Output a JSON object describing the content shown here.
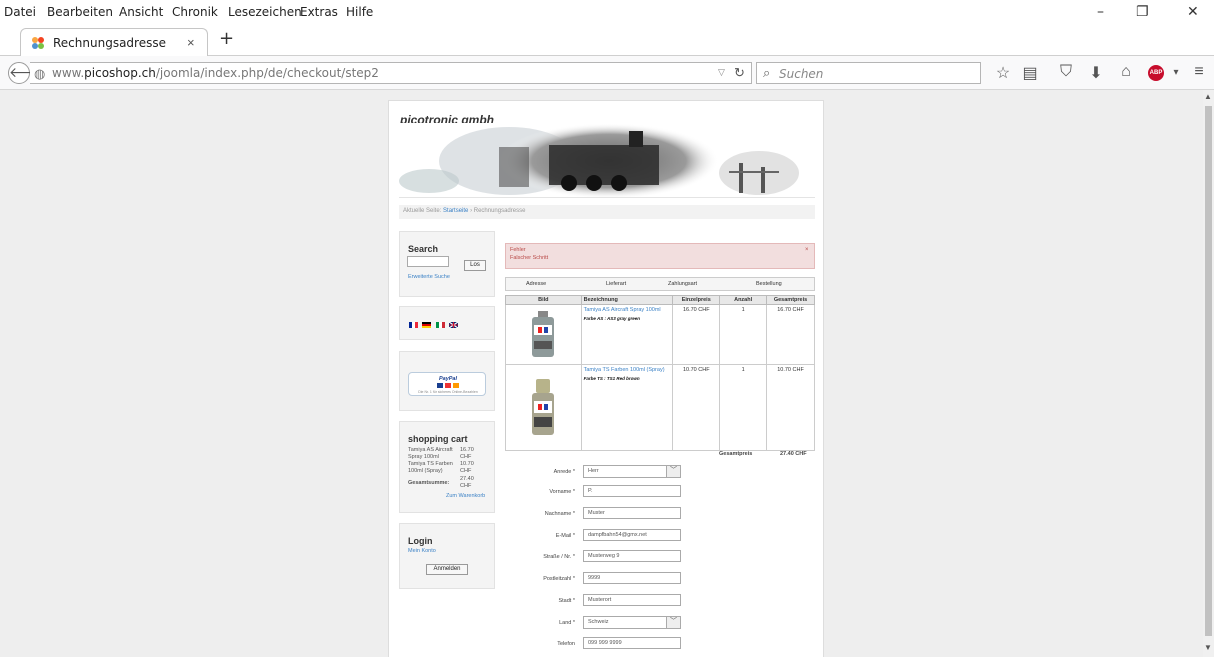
{
  "menubar": {
    "items": [
      "Datei",
      "Bearbeiten",
      "Ansicht",
      "Chronik",
      "Lesezeichen",
      "Extras",
      "Hilfe"
    ],
    "minimize": "–",
    "restore": "❐",
    "close": "✕"
  },
  "tab": {
    "title": "Rechnungsadresse",
    "close": "×",
    "new_tab": "+"
  },
  "nav": {
    "url_prefix": "www.",
    "url_host": "picoshop.ch",
    "url_path": "/joomla/index.php/de/checkout/step2",
    "search_placeholder": "Suchen"
  },
  "site": {
    "brand": "picotronic gmbh",
    "breadcrumb": {
      "label": "Aktuelle Seite:",
      "home": "Startseite",
      "sep": "›",
      "current": "Rechnungsadresse"
    }
  },
  "sidebar": {
    "search": {
      "title": "Search",
      "button": "Los",
      "advanced": "Erweiterte Suche"
    },
    "payment": {
      "logo_text": "PayPal",
      "tagline": "Die Nr. 1 für sicheres Online-Bezahlen"
    },
    "cart": {
      "title": "shopping cart",
      "items": [
        {
          "name": "Tamiya AS Aircraft Spray 100ml",
          "price": "16.70 CHF"
        },
        {
          "name": "Tamiya TS Farben 100ml (Spray)",
          "price": "10.70 CHF"
        }
      ],
      "total_label": "Gesamtsumme:",
      "total": "27.40 CHF",
      "link": "Zum Warenkorb"
    },
    "login": {
      "title": "Login",
      "account": "Mein Konto",
      "button": "Anmelden"
    }
  },
  "alert": {
    "title": "Fehler",
    "message": "Falscher Schritt",
    "close": "×"
  },
  "steps": [
    "Adresse",
    "Lieferart",
    "Zahlungsart",
    "Bestellung"
  ],
  "table": {
    "headers": [
      "Bild",
      "Bezeichnung",
      "Einzelpreis",
      "Anzahl",
      "Gesamtpreis"
    ],
    "rows": [
      {
        "name": "Tamiya AS Aircraft Spray 100ml",
        "attr": "Farbe AS : AS3 gray green",
        "unit": "16.70 CHF",
        "qty": "1",
        "total": "16.70 CHF"
      },
      {
        "name": "Tamiya TS Farben 100ml (Spray)",
        "attr": "Farbe TS : TS1 Red brown",
        "unit": "10.70 CHF",
        "qty": "1",
        "total": "10.70 CHF"
      }
    ],
    "total_label": "Gesamtpreis",
    "total_value": "27.40 CHF"
  },
  "form": {
    "anrede": {
      "label": "Anrede *",
      "value": "Herr"
    },
    "vorname": {
      "label": "Vorname *",
      "value": "P."
    },
    "nachname": {
      "label": "Nachname *",
      "value": "Muster"
    },
    "email": {
      "label": "E-Mail *",
      "value": "dampfbahn54@gmx.net"
    },
    "strasse": {
      "label": "Straße / Nr. *",
      "value": "Musterweg 9"
    },
    "plz": {
      "label": "Postleitzahl *",
      "value": "9999"
    },
    "stadt": {
      "label": "Stadt *",
      "value": "Musterort"
    },
    "land": {
      "label": "Land *",
      "value": "Schweiz"
    },
    "telefon": {
      "label": "Telefon",
      "value": "099 999 9999"
    }
  }
}
